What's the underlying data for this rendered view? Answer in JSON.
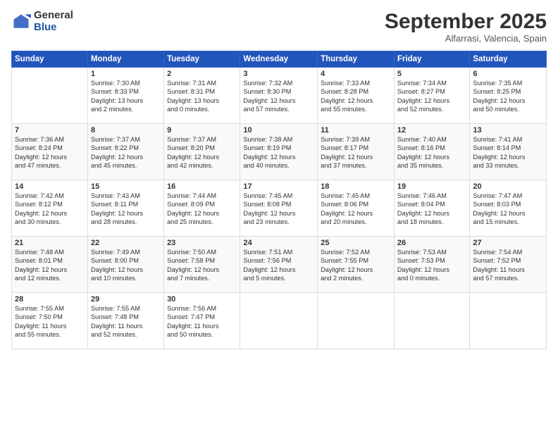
{
  "logo": {
    "general": "General",
    "blue": "Blue"
  },
  "header": {
    "month": "September 2025",
    "location": "Alfarrasi, Valencia, Spain"
  },
  "days_of_week": [
    "Sunday",
    "Monday",
    "Tuesday",
    "Wednesday",
    "Thursday",
    "Friday",
    "Saturday"
  ],
  "weeks": [
    [
      {
        "day": "",
        "info": ""
      },
      {
        "day": "1",
        "info": "Sunrise: 7:30 AM\nSunset: 8:33 PM\nDaylight: 13 hours\nand 2 minutes."
      },
      {
        "day": "2",
        "info": "Sunrise: 7:31 AM\nSunset: 8:31 PM\nDaylight: 13 hours\nand 0 minutes."
      },
      {
        "day": "3",
        "info": "Sunrise: 7:32 AM\nSunset: 8:30 PM\nDaylight: 12 hours\nand 57 minutes."
      },
      {
        "day": "4",
        "info": "Sunrise: 7:33 AM\nSunset: 8:28 PM\nDaylight: 12 hours\nand 55 minutes."
      },
      {
        "day": "5",
        "info": "Sunrise: 7:34 AM\nSunset: 8:27 PM\nDaylight: 12 hours\nand 52 minutes."
      },
      {
        "day": "6",
        "info": "Sunrise: 7:35 AM\nSunset: 8:25 PM\nDaylight: 12 hours\nand 50 minutes."
      }
    ],
    [
      {
        "day": "7",
        "info": "Sunrise: 7:36 AM\nSunset: 8:24 PM\nDaylight: 12 hours\nand 47 minutes."
      },
      {
        "day": "8",
        "info": "Sunrise: 7:37 AM\nSunset: 8:22 PM\nDaylight: 12 hours\nand 45 minutes."
      },
      {
        "day": "9",
        "info": "Sunrise: 7:37 AM\nSunset: 8:20 PM\nDaylight: 12 hours\nand 42 minutes."
      },
      {
        "day": "10",
        "info": "Sunrise: 7:38 AM\nSunset: 8:19 PM\nDaylight: 12 hours\nand 40 minutes."
      },
      {
        "day": "11",
        "info": "Sunrise: 7:39 AM\nSunset: 8:17 PM\nDaylight: 12 hours\nand 37 minutes."
      },
      {
        "day": "12",
        "info": "Sunrise: 7:40 AM\nSunset: 8:16 PM\nDaylight: 12 hours\nand 35 minutes."
      },
      {
        "day": "13",
        "info": "Sunrise: 7:41 AM\nSunset: 8:14 PM\nDaylight: 12 hours\nand 33 minutes."
      }
    ],
    [
      {
        "day": "14",
        "info": "Sunrise: 7:42 AM\nSunset: 8:12 PM\nDaylight: 12 hours\nand 30 minutes."
      },
      {
        "day": "15",
        "info": "Sunrise: 7:43 AM\nSunset: 8:11 PM\nDaylight: 12 hours\nand 28 minutes."
      },
      {
        "day": "16",
        "info": "Sunrise: 7:44 AM\nSunset: 8:09 PM\nDaylight: 12 hours\nand 25 minutes."
      },
      {
        "day": "17",
        "info": "Sunrise: 7:45 AM\nSunset: 8:08 PM\nDaylight: 12 hours\nand 23 minutes."
      },
      {
        "day": "18",
        "info": "Sunrise: 7:45 AM\nSunset: 8:06 PM\nDaylight: 12 hours\nand 20 minutes."
      },
      {
        "day": "19",
        "info": "Sunrise: 7:46 AM\nSunset: 8:04 PM\nDaylight: 12 hours\nand 18 minutes."
      },
      {
        "day": "20",
        "info": "Sunrise: 7:47 AM\nSunset: 8:03 PM\nDaylight: 12 hours\nand 15 minutes."
      }
    ],
    [
      {
        "day": "21",
        "info": "Sunrise: 7:48 AM\nSunset: 8:01 PM\nDaylight: 12 hours\nand 12 minutes."
      },
      {
        "day": "22",
        "info": "Sunrise: 7:49 AM\nSunset: 8:00 PM\nDaylight: 12 hours\nand 10 minutes."
      },
      {
        "day": "23",
        "info": "Sunrise: 7:50 AM\nSunset: 7:58 PM\nDaylight: 12 hours\nand 7 minutes."
      },
      {
        "day": "24",
        "info": "Sunrise: 7:51 AM\nSunset: 7:56 PM\nDaylight: 12 hours\nand 5 minutes."
      },
      {
        "day": "25",
        "info": "Sunrise: 7:52 AM\nSunset: 7:55 PM\nDaylight: 12 hours\nand 2 minutes."
      },
      {
        "day": "26",
        "info": "Sunrise: 7:53 AM\nSunset: 7:53 PM\nDaylight: 12 hours\nand 0 minutes."
      },
      {
        "day": "27",
        "info": "Sunrise: 7:54 AM\nSunset: 7:52 PM\nDaylight: 11 hours\nand 57 minutes."
      }
    ],
    [
      {
        "day": "28",
        "info": "Sunrise: 7:55 AM\nSunset: 7:50 PM\nDaylight: 11 hours\nand 55 minutes."
      },
      {
        "day": "29",
        "info": "Sunrise: 7:55 AM\nSunset: 7:48 PM\nDaylight: 11 hours\nand 52 minutes."
      },
      {
        "day": "30",
        "info": "Sunrise: 7:56 AM\nSunset: 7:47 PM\nDaylight: 11 hours\nand 50 minutes."
      },
      {
        "day": "",
        "info": ""
      },
      {
        "day": "",
        "info": ""
      },
      {
        "day": "",
        "info": ""
      },
      {
        "day": "",
        "info": ""
      }
    ]
  ]
}
